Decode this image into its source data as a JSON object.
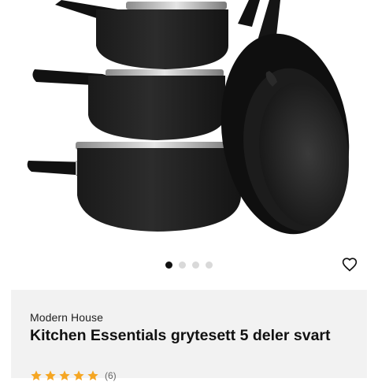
{
  "product": {
    "brand": "Modern House",
    "title": "Kitchen Essentials grytesett 5 deler svart",
    "rating_count": "(6)",
    "rating_stars": 5,
    "image_name": "cookware-set-image"
  },
  "gallery": {
    "total_images": 4,
    "active_index": 0
  },
  "colors": {
    "star": "#f5a623",
    "card_background": "#f2f2f2",
    "active_dot": "#111111",
    "inactive_dot": "#d9d9d9"
  },
  "icons": {
    "favorite": "heart-outline-icon",
    "rating": "star-icon"
  }
}
